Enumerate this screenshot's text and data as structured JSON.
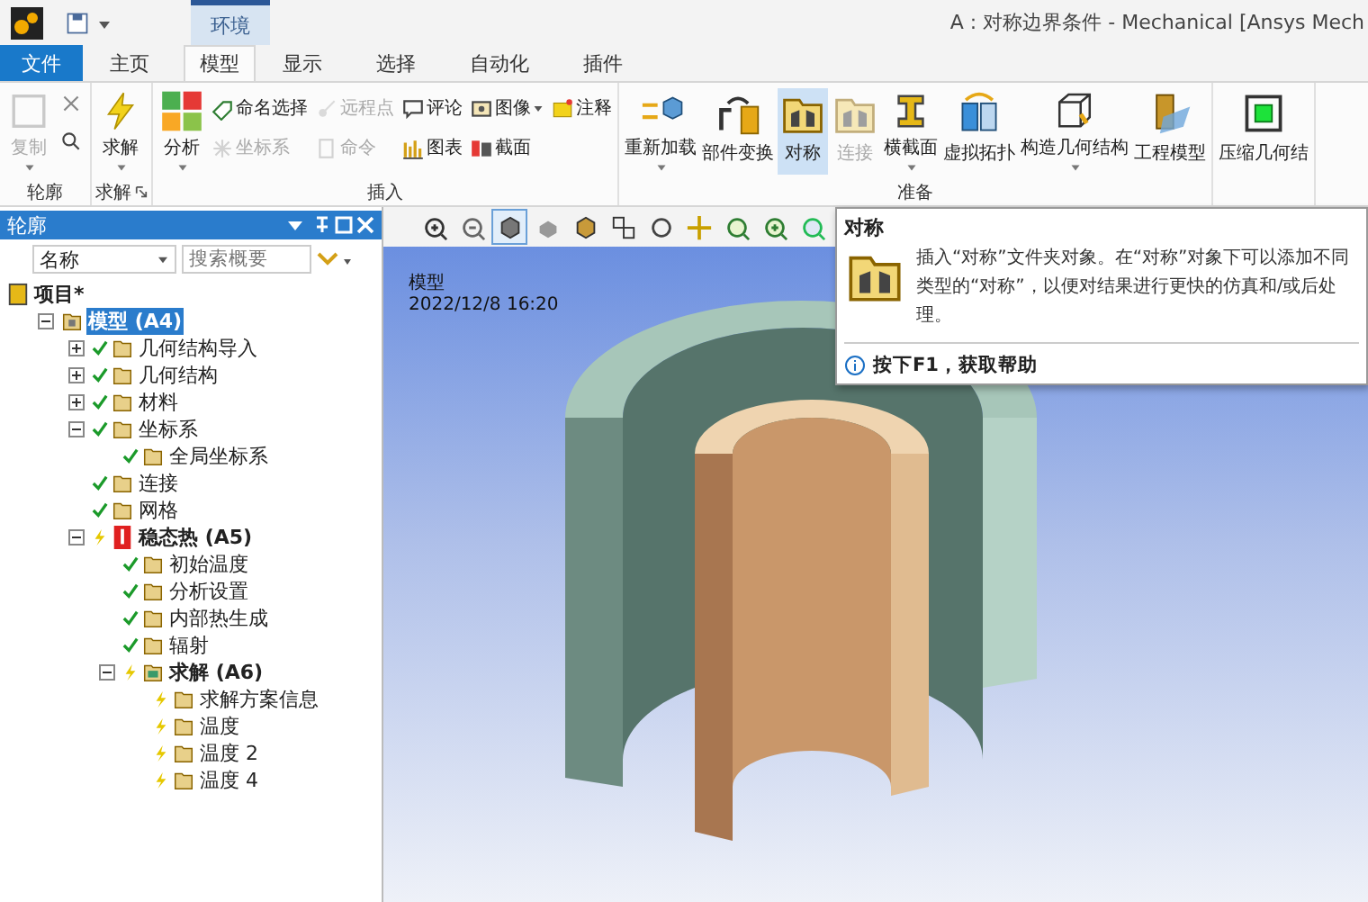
{
  "title_bar": {
    "context_group": "环境",
    "title": "A : 对称边界条件 - Mechanical [Ansys Mech"
  },
  "tabs": [
    {
      "label": "文件",
      "kind": "file",
      "selected": false
    },
    {
      "label": "主页",
      "kind": "tab",
      "selected": false
    },
    {
      "label": "模型",
      "kind": "tab",
      "selected": true
    },
    {
      "label": "显示",
      "kind": "tab",
      "selected": false
    },
    {
      "label": "选择",
      "kind": "tab",
      "selected": false
    },
    {
      "label": "自动化",
      "kind": "tab",
      "selected": false
    },
    {
      "label": "插件",
      "kind": "tab",
      "selected": false
    }
  ],
  "ribbon": {
    "groups": [
      {
        "label": "轮廓",
        "items": [
          {
            "kind": "large",
            "label": "复制",
            "disabled": true,
            "dropdown": true
          },
          {
            "kind": "icon",
            "disabled": false
          },
          {
            "kind": "icon",
            "disabled": false
          }
        ]
      },
      {
        "label": "求解",
        "launcher": true,
        "items": [
          {
            "kind": "large",
            "label": "求解",
            "disabled": false,
            "dropdown": true
          }
        ]
      },
      {
        "label": "插入",
        "items": [
          {
            "kind": "large",
            "label": "分析",
            "disabled": false,
            "dropdown": true
          },
          {
            "kind": "small",
            "label": "命名选择",
            "disabled": false,
            "dropdown": false
          },
          {
            "kind": "small",
            "label": "坐标系",
            "disabled": true,
            "dropdown": false
          },
          {
            "kind": "small",
            "label": "远程点",
            "disabled": true,
            "dropdown": false
          },
          {
            "kind": "small",
            "label": "命令",
            "disabled": true,
            "dropdown": false
          },
          {
            "kind": "small",
            "label": "评论",
            "disabled": false,
            "dropdown": false
          },
          {
            "kind": "small",
            "label": "图表",
            "disabled": false,
            "dropdown": false
          },
          {
            "kind": "small",
            "label": "图像",
            "disabled": false,
            "dropdown": true
          },
          {
            "kind": "small",
            "label": "截面",
            "disabled": false,
            "dropdown": false
          },
          {
            "kind": "small",
            "label": "注释",
            "disabled": false,
            "dropdown": false
          }
        ]
      },
      {
        "label": "准备",
        "items": [
          {
            "kind": "large",
            "label": "重新加载",
            "disabled": false,
            "dropdown": true,
            "selected": false
          },
          {
            "kind": "large",
            "label": "部件变换",
            "disabled": false,
            "dropdown": false,
            "selected": false
          },
          {
            "kind": "large",
            "label": "对称",
            "disabled": false,
            "dropdown": false,
            "selected": true
          },
          {
            "kind": "large",
            "label": "连接",
            "disabled": true,
            "dropdown": false,
            "selected": false
          },
          {
            "kind": "large",
            "label": "横截面",
            "disabled": false,
            "dropdown": true,
            "selected": false
          },
          {
            "kind": "large",
            "label": "虚拟拓扑",
            "disabled": false,
            "dropdown": false,
            "selected": false
          },
          {
            "kind": "large",
            "label": "构造几何结构",
            "disabled": false,
            "dropdown": true,
            "selected": false
          },
          {
            "kind": "large",
            "label": "工程模型",
            "disabled": false,
            "dropdown": false,
            "selected": false
          }
        ]
      },
      {
        "items": [
          {
            "kind": "large",
            "label": "压缩几何结",
            "disabled": false,
            "dropdown": false
          }
        ]
      }
    ]
  },
  "outline": {
    "title": "轮廓",
    "filter": {
      "value": "名称",
      "placeholder": "搜索概要"
    },
    "tree": [
      {
        "label": "项目*",
        "kind": "project",
        "selected": false,
        "children": [
          {
            "label": "模型 (A4)",
            "kind": "model",
            "selected": true,
            "expanded": true,
            "children": [
              {
                "label": "几何结构导入",
                "kind": "item",
                "solved": true,
                "selected": false,
                "expanded": false
              },
              {
                "label": "几何结构",
                "kind": "item",
                "solved": true,
                "selected": false,
                "expanded": false
              },
              {
                "label": "材料",
                "kind": "item",
                "solved": true,
                "selected": false,
                "expanded": false
              },
              {
                "label": "坐标系",
                "kind": "item",
                "solved": true,
                "selected": false,
                "expanded": true,
                "children": [
                  {
                    "label": "全局坐标系",
                    "kind": "item",
                    "solved": true,
                    "selected": false
                  }
                ]
              },
              {
                "label": "连接",
                "kind": "item",
                "solved": true,
                "selected": false
              },
              {
                "label": "网格",
                "kind": "item",
                "solved": true,
                "selected": false
              },
              {
                "label": "稳态热 (A5)",
                "kind": "analysis",
                "solved": false,
                "selected": false,
                "expanded": true,
                "children": [
                  {
                    "label": "初始温度",
                    "kind": "item",
                    "solved": true,
                    "selected": false
                  },
                  {
                    "label": "分析设置",
                    "kind": "item",
                    "solved": true,
                    "selected": false
                  },
                  {
                    "label": "内部热生成",
                    "kind": "item",
                    "solved": true,
                    "selected": false
                  },
                  {
                    "label": "辐射",
                    "kind": "item",
                    "solved": true,
                    "selected": false
                  },
                  {
                    "label": "求解 (A6)",
                    "kind": "solution",
                    "solved": false,
                    "selected": false,
                    "expanded": true,
                    "children": [
                      {
                        "label": "求解方案信息",
                        "kind": "item",
                        "solved": false,
                        "selected": false
                      },
                      {
                        "label": "温度",
                        "kind": "item",
                        "solved": false,
                        "selected": false
                      },
                      {
                        "label": "温度 2",
                        "kind": "item",
                        "solved": false,
                        "selected": false
                      },
                      {
                        "label": "温度 4",
                        "kind": "item",
                        "solved": false,
                        "selected": false
                      }
                    ]
                  }
                ]
              }
            ]
          }
        ]
      }
    ]
  },
  "viewport": {
    "toolbar": [
      {
        "selected": false
      },
      {
        "selected": false
      },
      {
        "selected": true
      },
      {
        "selected": false
      },
      {
        "selected": false
      },
      {
        "selected": false
      },
      {
        "selected": false
      },
      {
        "selected": false
      },
      {
        "selected": false
      },
      {
        "selected": false
      },
      {
        "selected": false
      }
    ],
    "label": "模型",
    "timestamp": "2022/12/8 16:20"
  },
  "tooltip": {
    "title": "对称",
    "body": "插入“对称”文件夹对象。在“对称”对象下可以添加不同类型的“对称”，以便对结果进行更快的仿真和/或后处理。",
    "help": "按下F1，获取帮助"
  }
}
